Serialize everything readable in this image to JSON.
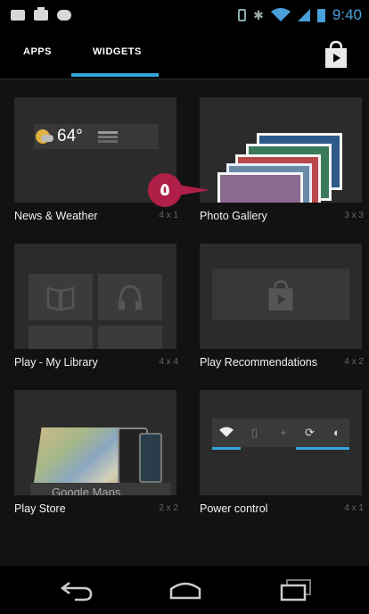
{
  "status_bar": {
    "time": "9:40"
  },
  "action_bar": {
    "tabs": [
      {
        "label": "APPS"
      },
      {
        "label": "WIDGETS"
      }
    ]
  },
  "widgets": [
    {
      "label": "News & Weather",
      "dims": "4 x 1",
      "preview": {
        "temp": "64°"
      }
    },
    {
      "label": "Photo Gallery",
      "dims": "3 x 3"
    },
    {
      "label": "Play - My Library",
      "dims": "4 x 4"
    },
    {
      "label": "Play Recommendations",
      "dims": "4 x 2"
    },
    {
      "label": "Play Store",
      "dims": "2 x 2",
      "preview": {
        "map_text": "Google Maps"
      }
    },
    {
      "label": "Power control",
      "dims": "4 x 1"
    }
  ],
  "badge": {
    "text": "٥"
  },
  "colors": {
    "accent": "#33a4dd",
    "badge": "#b01f48",
    "background": "#121212"
  },
  "icons": [
    "message-icon",
    "bag-icon",
    "gamepad-icon",
    "vibrate-icon",
    "bluetooth-icon",
    "wifi-icon",
    "signal-icon",
    "battery-icon",
    "store-icon",
    "back-icon",
    "home-icon",
    "recents-icon"
  ]
}
